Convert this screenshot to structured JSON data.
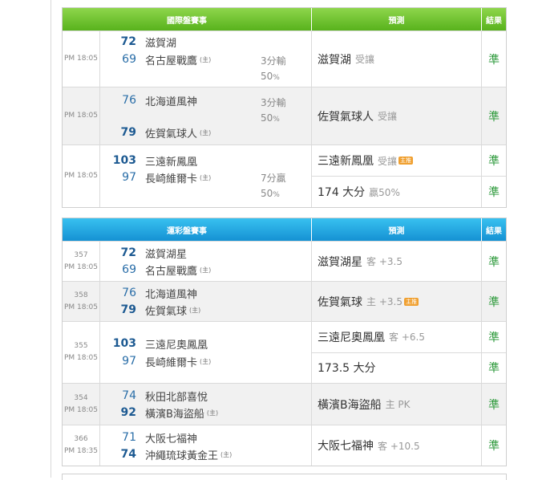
{
  "panels": [
    {
      "header": {
        "match": "國際盤賽事",
        "prediction": "預測",
        "result": "結果"
      },
      "rows": [
        {
          "time": "PM 18:05",
          "away": {
            "score": "72",
            "name": "滋賀湖"
          },
          "home": {
            "score": "69",
            "name": "名古屋戰鷹",
            "tag": "(主)"
          },
          "margin": {
            "text": "3分輸",
            "pct": "50",
            "pct_unit": "%"
          },
          "predictions": [
            {
              "text": "滋賀湖",
              "sub": "受讓",
              "result": "準"
            }
          ]
        },
        {
          "time": "PM 18:05",
          "away": {
            "score": "76",
            "name": "北海道風神"
          },
          "home": {
            "score": "79",
            "name": "佐賀氣球人",
            "tag": "(主)"
          },
          "margin": {
            "text": "3分輸",
            "pct": "50",
            "pct_unit": "%"
          },
          "predictions": [
            {
              "text": "佐賀氣球人",
              "sub": "受讓",
              "result": "準"
            }
          ]
        },
        {
          "time": "PM 18:05",
          "away": {
            "score": "103",
            "name": "三遠新鳳凰"
          },
          "home": {
            "score": "97",
            "name": "長崎維爾卡",
            "tag": "(主)"
          },
          "margin": {
            "text": "7分贏",
            "pct": "50",
            "pct_unit": "%"
          },
          "predictions": [
            {
              "text": "三遠新鳳凰",
              "sub": "受讓",
              "badge": "主推",
              "result": "準"
            },
            {
              "text": "174 大分",
              "sub": "贏50%",
              "result": "準"
            }
          ]
        }
      ]
    },
    {
      "header": {
        "match": "運彩盤賽事",
        "prediction": "預測",
        "result": "結果"
      },
      "rows": [
        {
          "num": "357",
          "time": "PM 18:05",
          "away": {
            "score": "72",
            "name": "滋賀湖星"
          },
          "home": {
            "score": "69",
            "name": "名古屋戰鷹",
            "tag": "(主)"
          },
          "predictions": [
            {
              "text": "滋賀湖星",
              "sub": "客 +3.5",
              "result": "準"
            }
          ]
        },
        {
          "num": "358",
          "time": "PM 18:05",
          "away": {
            "score": "76",
            "name": "北海道風神"
          },
          "home": {
            "score": "79",
            "name": "佐賀氣球",
            "tag": "(主)"
          },
          "predictions": [
            {
              "text": "佐賀氣球",
              "sub": "主 +3.5",
              "badge": "主推",
              "result": "準"
            }
          ]
        },
        {
          "num": "355",
          "time": "PM 18:05",
          "away": {
            "score": "103",
            "name": "三遠尼奧鳳凰"
          },
          "home": {
            "score": "97",
            "name": "長崎維爾卡",
            "tag": "(主)"
          },
          "predictions": [
            {
              "text": "三遠尼奧鳳凰",
              "sub": "客 +6.5",
              "result": "準"
            },
            {
              "text": "173.5 大分",
              "sub": "",
              "result": "準"
            }
          ]
        },
        {
          "num": "354",
          "time": "PM 18:05",
          "away": {
            "score": "74",
            "name": "秋田北部喜悅"
          },
          "home": {
            "score": "92",
            "name": "橫濱B海盜船",
            "tag": "(主)"
          },
          "predictions": [
            {
              "text": "橫濱B海盜船",
              "sub": "主 PK",
              "result": "準"
            }
          ]
        },
        {
          "num": "366",
          "time": "PM 18:35",
          "away": {
            "score": "71",
            "name": "大阪七福神"
          },
          "home": {
            "score": "74",
            "name": "沖繩琉球黃金王",
            "tag": "(主)"
          },
          "predictions": [
            {
              "text": "大阪七福神",
              "sub": "客 +10.5",
              "result": "準"
            }
          ]
        }
      ]
    }
  ]
}
